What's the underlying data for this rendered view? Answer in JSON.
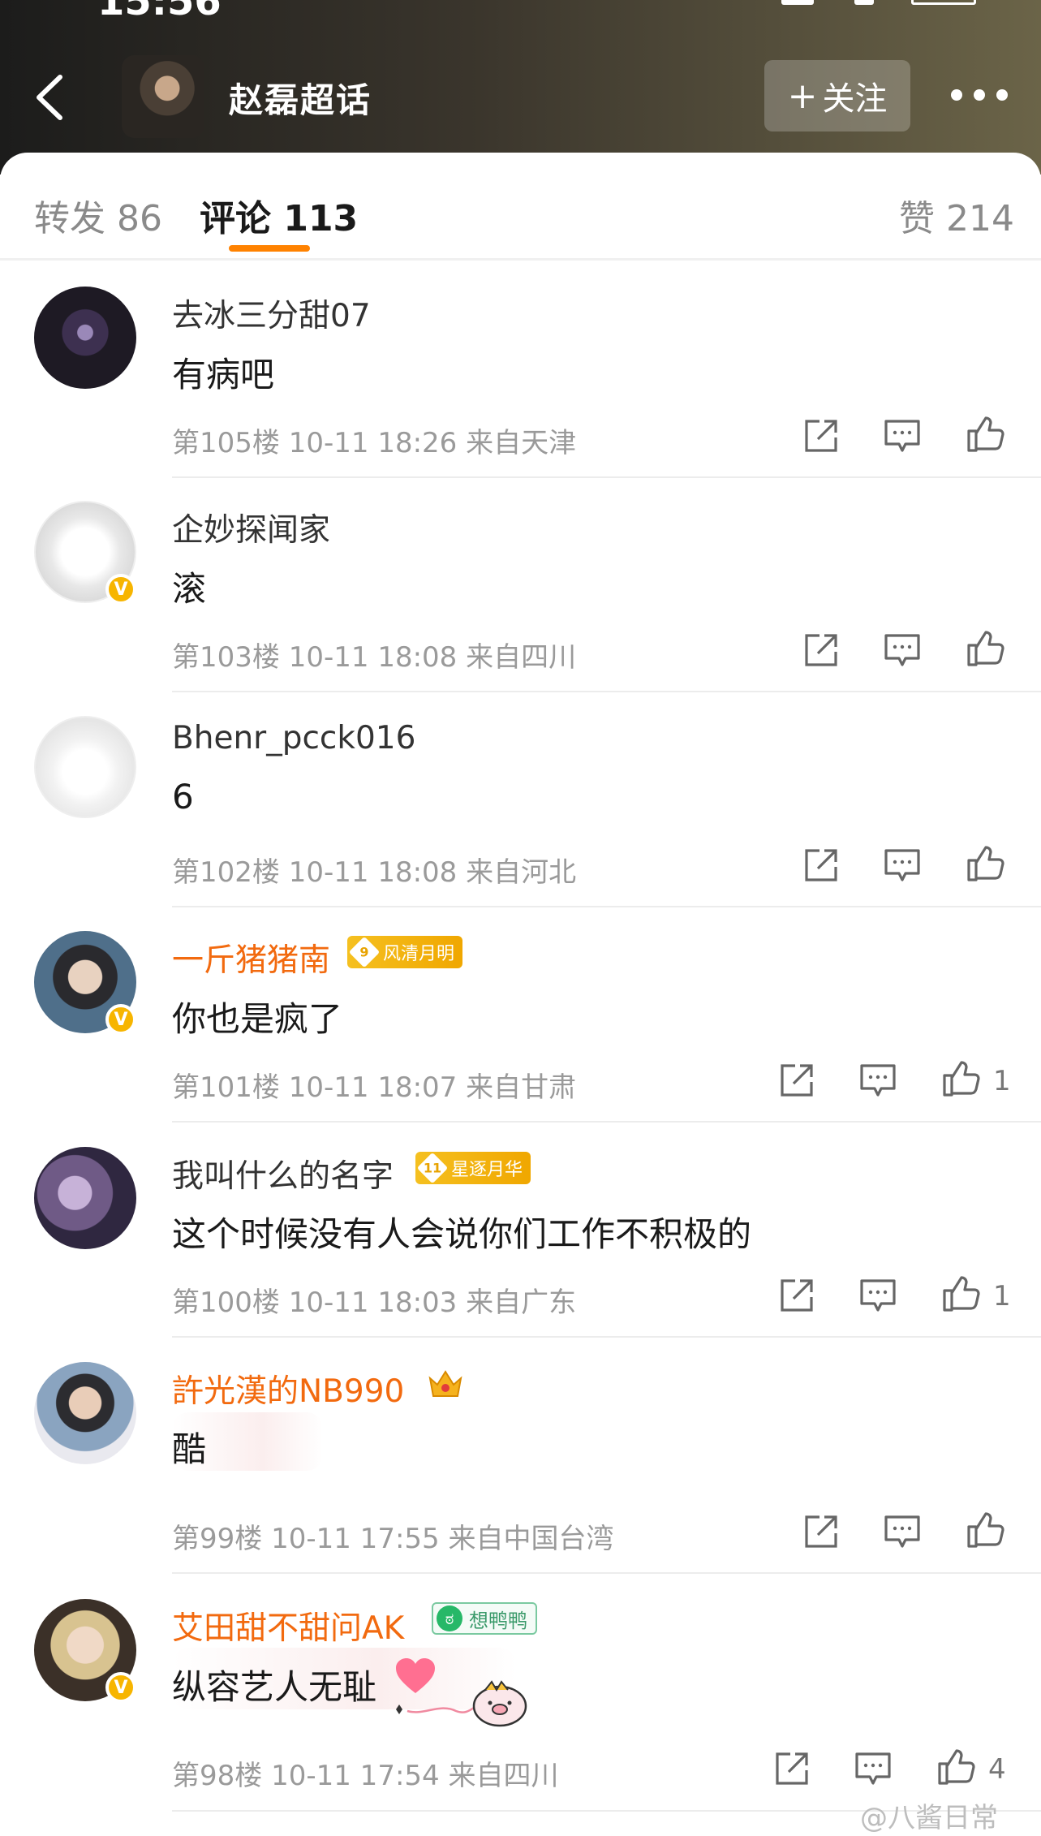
{
  "status": {
    "time_partial": "15:56"
  },
  "header": {
    "back_label": "返回",
    "title": "赵磊超话",
    "follow_label": "关注",
    "follow_plus": "+"
  },
  "tabs": [
    {
      "label": "转发",
      "count": "86"
    },
    {
      "label": "评论",
      "count": "113"
    },
    {
      "label": "赞",
      "count": "214"
    }
  ],
  "comments": [
    {
      "user": "去冰三分甜07",
      "text": "有病吧",
      "floor": "第105楼",
      "date": "10-11 18:26",
      "location": "来自天津",
      "likes": ""
    },
    {
      "user": "企妙探闻家",
      "text": "滚",
      "floor": "第103楼",
      "date": "10-11 18:08",
      "location": "来自四川",
      "likes": ""
    },
    {
      "user": "Bhenr_pcck016",
      "text": "6",
      "floor": "第102楼",
      "date": "10-11 18:08",
      "location": "来自河北",
      "likes": ""
    },
    {
      "user": "一斤猪猪南",
      "text": "你也是疯了",
      "floor": "第101楼",
      "date": "10-11 18:07",
      "location": "来自甘肃",
      "likes": "1",
      "badge_level": "9",
      "badge_text": "风清月明"
    },
    {
      "user": "我叫什么的名字",
      "text": "这个时候没有人会说你们工作不积极的",
      "floor": "第100楼",
      "date": "10-11 18:03",
      "location": "来自广东",
      "likes": "1",
      "badge_level": "11",
      "badge_text": "星逐月华"
    },
    {
      "user": "許光漢的NB990",
      "text": "酷",
      "floor": "第99楼",
      "date": "10-11 17:55",
      "location": "来自中国台湾",
      "likes": ""
    },
    {
      "user": "艾田甜不甜问AK",
      "text": "纵容艺人无耻",
      "floor": "第98楼",
      "date": "10-11 17:54",
      "location": "来自四川",
      "likes": "4",
      "badge_text": "想鸭鸭"
    }
  ],
  "watermark": "@八酱日常",
  "colors": {
    "accent": "#ff8200",
    "username_vip": "#f26a0f",
    "verified": "#f7b500"
  },
  "icons": [
    "back-arrow-icon",
    "more-icon",
    "share-icon",
    "comment-icon",
    "like-icon",
    "verified-icon",
    "crown-icon"
  ]
}
